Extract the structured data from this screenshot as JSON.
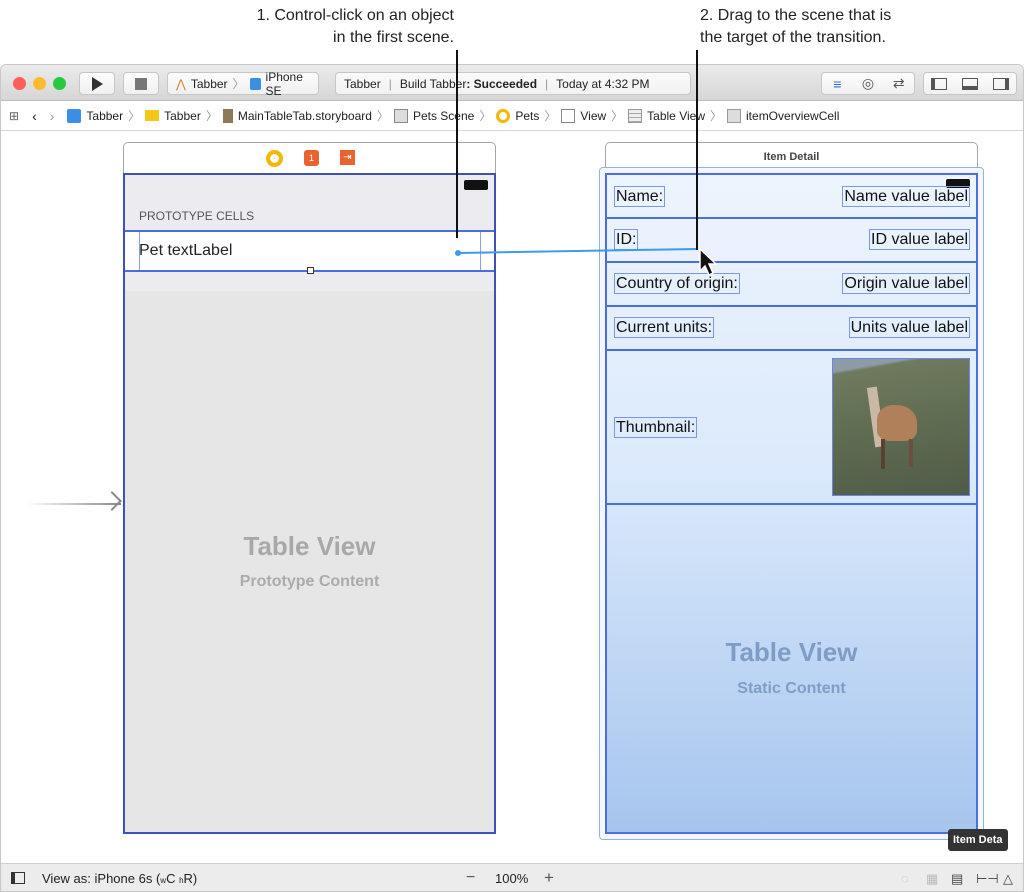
{
  "annotations": {
    "step1": [
      "1. Control-click on an object",
      "in the first scene."
    ],
    "step2": [
      "2. Drag to the scene that is",
      "the target of the transition."
    ]
  },
  "toolbar": {
    "scheme": "Tabber",
    "device": "iPhone SE",
    "status_app": "Tabber",
    "status_build": "Build Tabber",
    "status_result": ": Succeeded",
    "status_time": "Today at 4:32 PM"
  },
  "breadcrumb": [
    "Tabber",
    "Tabber",
    "MainTableTab.storyboard",
    "Pets Scene",
    "Pets",
    "View",
    "Table View",
    "itemOverviewCell"
  ],
  "left_scene": {
    "section_header": "PROTOTYPE CELLS",
    "cell_label": "Pet textLabel",
    "title": "Table View",
    "subtitle": "Prototype Content"
  },
  "right_scene": {
    "header": "Item Detail",
    "rows": [
      {
        "label": "Name:",
        "value": "Name value label"
      },
      {
        "label": "ID:",
        "value": "ID value label"
      },
      {
        "label": "Country of origin:",
        "value": "Origin value label"
      },
      {
        "label": "Current units:",
        "value": "Units value label"
      }
    ],
    "thumbnail_label": "Thumbnail:",
    "title": "Table View",
    "subtitle": "Static Content",
    "tooltip": "Item Deta"
  },
  "bottombar": {
    "view_as": "View as: iPhone 6s (",
    "w": "w",
    "c": "C ",
    "h": "h",
    "r": "R)",
    "zoom": "100%"
  },
  "colors": {
    "accent": "#3b6fe0",
    "selection": "#4a6ee0",
    "connection": "#3d9be9"
  }
}
